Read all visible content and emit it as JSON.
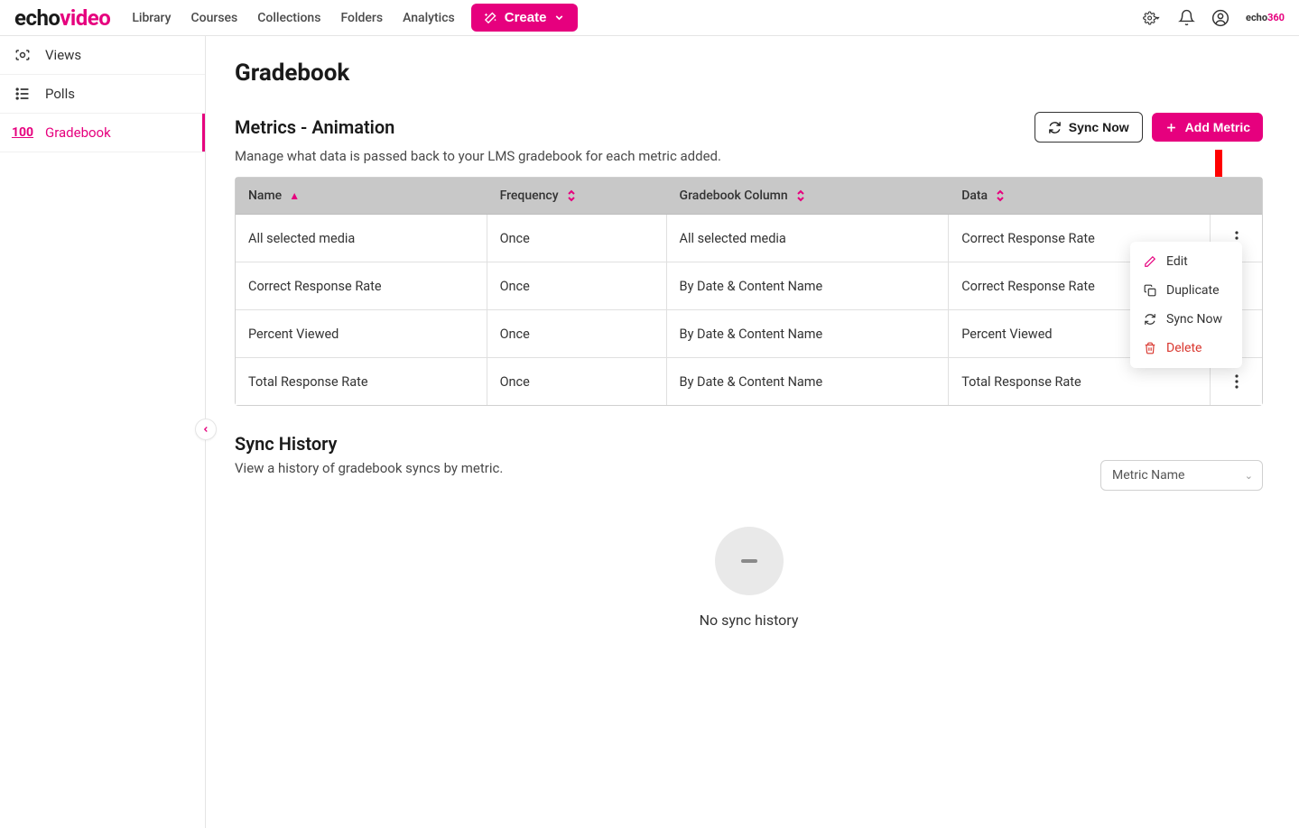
{
  "brand": {
    "part1": "echo",
    "part2": "video"
  },
  "mini_brand": {
    "part1": "echo",
    "part2": "360"
  },
  "nav": {
    "library": "Library",
    "courses": "Courses",
    "collections": "Collections",
    "folders": "Folders",
    "analytics": "Analytics",
    "create": "Create"
  },
  "sidebar": {
    "items": [
      {
        "label": "Views"
      },
      {
        "label": "Polls"
      },
      {
        "label": "Gradebook"
      }
    ]
  },
  "page": {
    "title": "Gradebook",
    "metrics_title": "Metrics - Animation",
    "metrics_subtext": "Manage what data is passed back to your LMS gradebook for each metric added.",
    "sync_now": "Sync Now",
    "add_metric": "Add Metric"
  },
  "table": {
    "headers": {
      "name": "Name",
      "frequency": "Frequency",
      "gradebook": "Gradebook Column",
      "data": "Data"
    },
    "rows": [
      {
        "name": "All selected media",
        "frequency": "Once",
        "gradebook": "All selected media",
        "data": "Correct Response Rate"
      },
      {
        "name": "Correct Response Rate",
        "frequency": "Once",
        "gradebook": "By Date & Content Name",
        "data": "Correct Response Rate"
      },
      {
        "name": "Percent Viewed",
        "frequency": "Once",
        "gradebook": "By Date & Content Name",
        "data": "Percent Viewed"
      },
      {
        "name": "Total Response Rate",
        "frequency": "Once",
        "gradebook": "By Date & Content Name",
        "data": "Total Response Rate"
      }
    ]
  },
  "popover": {
    "edit": "Edit",
    "duplicate": "Duplicate",
    "sync_now": "Sync Now",
    "delete": "Delete"
  },
  "sync_history": {
    "title": "Sync History",
    "subtext": "View a history of gradebook syncs by metric.",
    "select_placeholder": "Metric Name",
    "empty": "No sync history"
  }
}
